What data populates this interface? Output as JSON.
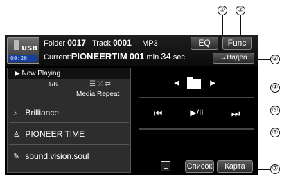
{
  "callouts": [
    "①",
    "②",
    "③",
    "④",
    "⑤",
    "⑥",
    "⑦"
  ],
  "header": {
    "source_label": "USB",
    "elapsed_time": "00:26",
    "folder_label": "Folder",
    "folder_number": "0017",
    "track_label": "Track",
    "track_number": "0001",
    "format": "MP3",
    "current_label": "Current:",
    "current_file": "PIONEERTIM",
    "current_index": "001",
    "min_label": "min",
    "seconds_value": "34",
    "sec_label": "sec"
  },
  "buttons": {
    "eq": "EQ",
    "func": "Func",
    "video": "↔Видео",
    "list": "Список",
    "map": "Карта"
  },
  "now_playing": {
    "header": "▶  Now Playing",
    "track_count": "1/6",
    "repeat_icons": "☰ ⤨ ⇄",
    "repeat_mode": "Media Repeat"
  },
  "track_info": {
    "title": "Brilliance",
    "artist": "PIONEER TIME",
    "album": "sound.vision.soul"
  },
  "controls": {
    "folder_prev": "◄",
    "folder_next": "►",
    "prev_track": "⏮",
    "play_pause": "▶/II",
    "next_track": "⏭"
  },
  "icons": {
    "title": "♪",
    "artist": "♙",
    "album": "✎"
  },
  "colors": {
    "screen_bg": "#000000",
    "panel_bg": "#2d2d2d",
    "time_bg": "#183f9c"
  }
}
